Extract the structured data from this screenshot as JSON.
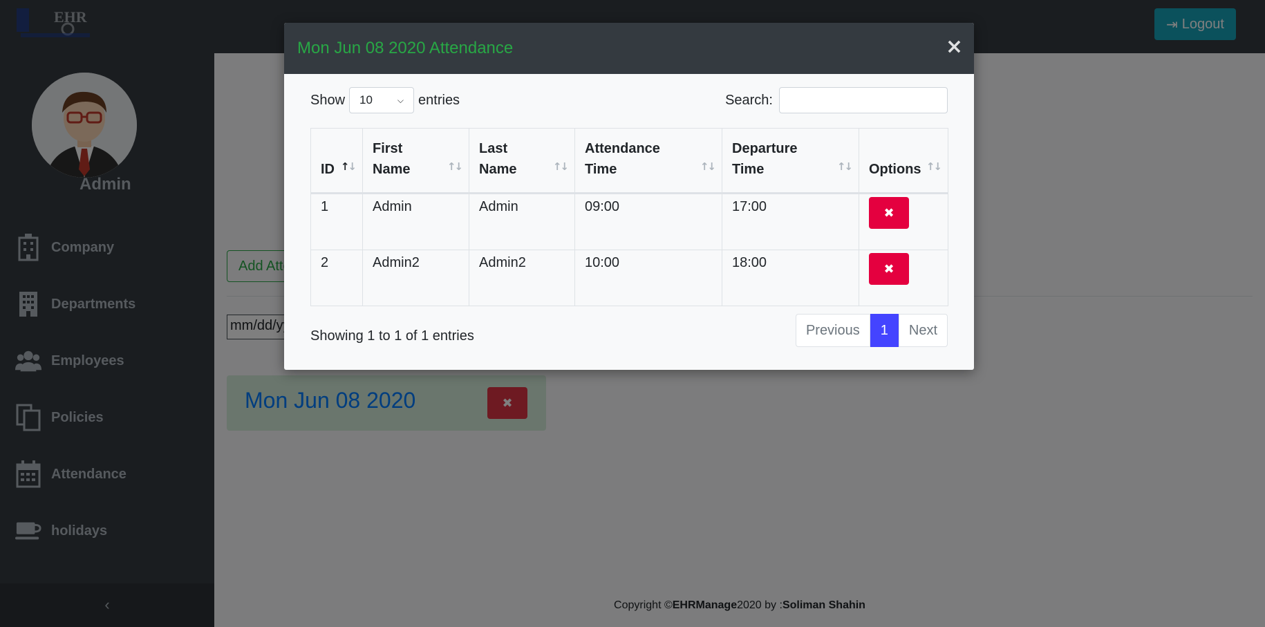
{
  "app": {
    "logo_text": "EHR",
    "logout_label": "Logout",
    "user_name": "Admin"
  },
  "sidebar": {
    "items": [
      {
        "label": "Company",
        "icon": "building-icon"
      },
      {
        "label": "Departments",
        "icon": "office-building-icon"
      },
      {
        "label": "Employees",
        "icon": "users-icon"
      },
      {
        "label": "Policies",
        "icon": "documents-icon"
      },
      {
        "label": "Attendance",
        "icon": "calendar-icon"
      },
      {
        "label": "holidays",
        "icon": "coffee-icon"
      }
    ],
    "collapse_label": "‹"
  },
  "content": {
    "add_attendance_label": "Add Attendance",
    "date_placeholder": "mm/dd/yyyy",
    "day_card_title": "Mon Jun 08 2020"
  },
  "footer": {
    "prefix": "Copyright © ",
    "brand": "EHRManage",
    "middle": " 2020 by : ",
    "author": "Soliman Shahin"
  },
  "modal": {
    "title": "Mon Jun 08 2020 Attendance",
    "close_label": "×",
    "show_label": "Show",
    "entries_value": "10",
    "entries_label": "entries",
    "search_label": "Search:",
    "columns": [
      "ID",
      "First Name",
      "Last Name",
      "Attendance Time",
      "Departure Time",
      "Options"
    ],
    "rows": [
      {
        "id": "1",
        "first": "Admin",
        "last": "Admin",
        "attendance": "09:00",
        "departure": "17:00"
      },
      {
        "id": "2",
        "first": "Admin2",
        "last": "Admin2",
        "attendance": "10:00",
        "departure": "18:00"
      }
    ],
    "info": "Showing 1 to 1 of 1 entries",
    "pagination": {
      "previous": "Previous",
      "current": "1",
      "next": "Next"
    }
  },
  "colors": {
    "accent_green": "#28a745",
    "danger": "#e4003f",
    "page_active": "#4444ff",
    "header_dark": "#343a40"
  }
}
